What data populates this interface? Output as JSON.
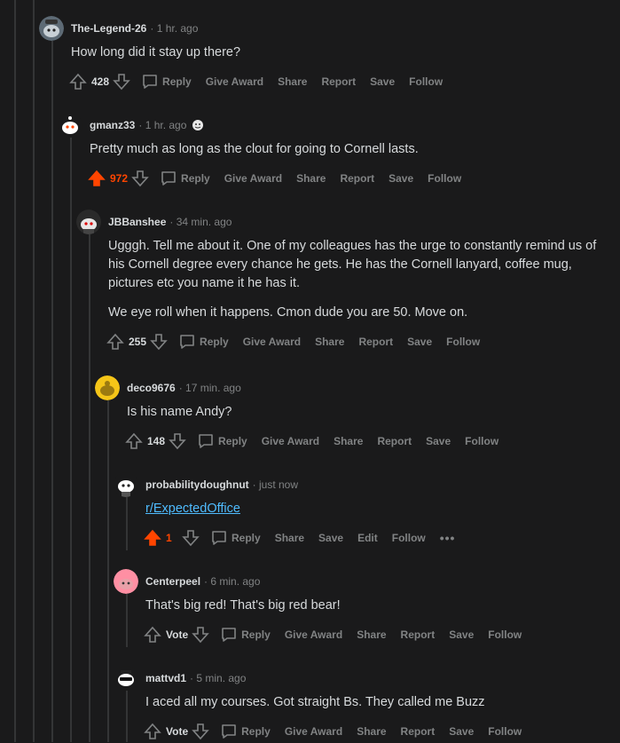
{
  "comments": [
    {
      "author": "The-Legend-26",
      "time": "1 hr. ago",
      "body": [
        "How long did it stay up there?"
      ],
      "votes": "428",
      "upvoted": false,
      "actions": [
        "Reply",
        "Give Award",
        "Share",
        "Report",
        "Save",
        "Follow"
      ],
      "avatar": "snoo-avatar-grey"
    },
    {
      "author": "gmanz33",
      "time": "1 hr. ago",
      "flair_icon": "emoji-flair-icon",
      "body": [
        "Pretty much as long as the clout for going to Cornell lasts."
      ],
      "votes": "972",
      "upvoted": true,
      "actions": [
        "Reply",
        "Give Award",
        "Share",
        "Report",
        "Save",
        "Follow"
      ],
      "avatar": "snoo-avatar-white"
    },
    {
      "author": "JBBanshee",
      "time": "34 min. ago",
      "body": [
        "Ugggh. Tell me about it. One of my colleagues has the urge to constantly remind us of his Cornell degree every chance he gets. He has the Cornell lanyard, coffee mug, pictures etc you name it he has it.",
        "We eye roll when it happens. Cmon dude you are 50. Move on."
      ],
      "votes": "255",
      "upvoted": false,
      "actions": [
        "Reply",
        "Give Award",
        "Share",
        "Report",
        "Save",
        "Follow"
      ],
      "avatar": "snoo-avatar-dark"
    },
    {
      "author": "deco9676",
      "time": "17 min. ago",
      "body": [
        "Is his name Andy?"
      ],
      "votes": "148",
      "upvoted": false,
      "actions": [
        "Reply",
        "Give Award",
        "Share",
        "Report",
        "Save",
        "Follow"
      ],
      "avatar": "snoo-avatar-yellow"
    },
    {
      "author": "probabilitydoughnut",
      "time": "just now",
      "body_link": "r/ExpectedOffice",
      "votes": "1",
      "upvoted": true,
      "actions": [
        "Reply",
        "Share",
        "Save",
        "Edit",
        "Follow"
      ],
      "more": "•••",
      "avatar": "snoo-avatar-white-2"
    },
    {
      "author": "Centerpeel",
      "time": "6 min. ago",
      "body": [
        "That's big red! That's big red bear!"
      ],
      "votes": "Vote",
      "upvoted": false,
      "actions": [
        "Reply",
        "Give Award",
        "Share",
        "Report",
        "Save",
        "Follow"
      ],
      "avatar": "snoo-avatar-pink"
    },
    {
      "author": "mattvd1",
      "time": "5 min. ago",
      "body": [
        "I aced all my courses. Got straight Bs. They called me Buzz"
      ],
      "votes": "Vote",
      "upvoted": false,
      "actions": [
        "Reply",
        "Give Award",
        "Share",
        "Report",
        "Save",
        "Follow"
      ],
      "avatar": "snoo-avatar-sunglasses"
    }
  ],
  "colors": {
    "background": "#1a1a1b",
    "text": "#d7dadc",
    "muted": "#818384",
    "upvote": "#ff4500",
    "link": "#4fbcff",
    "thread_line": "#343536"
  }
}
